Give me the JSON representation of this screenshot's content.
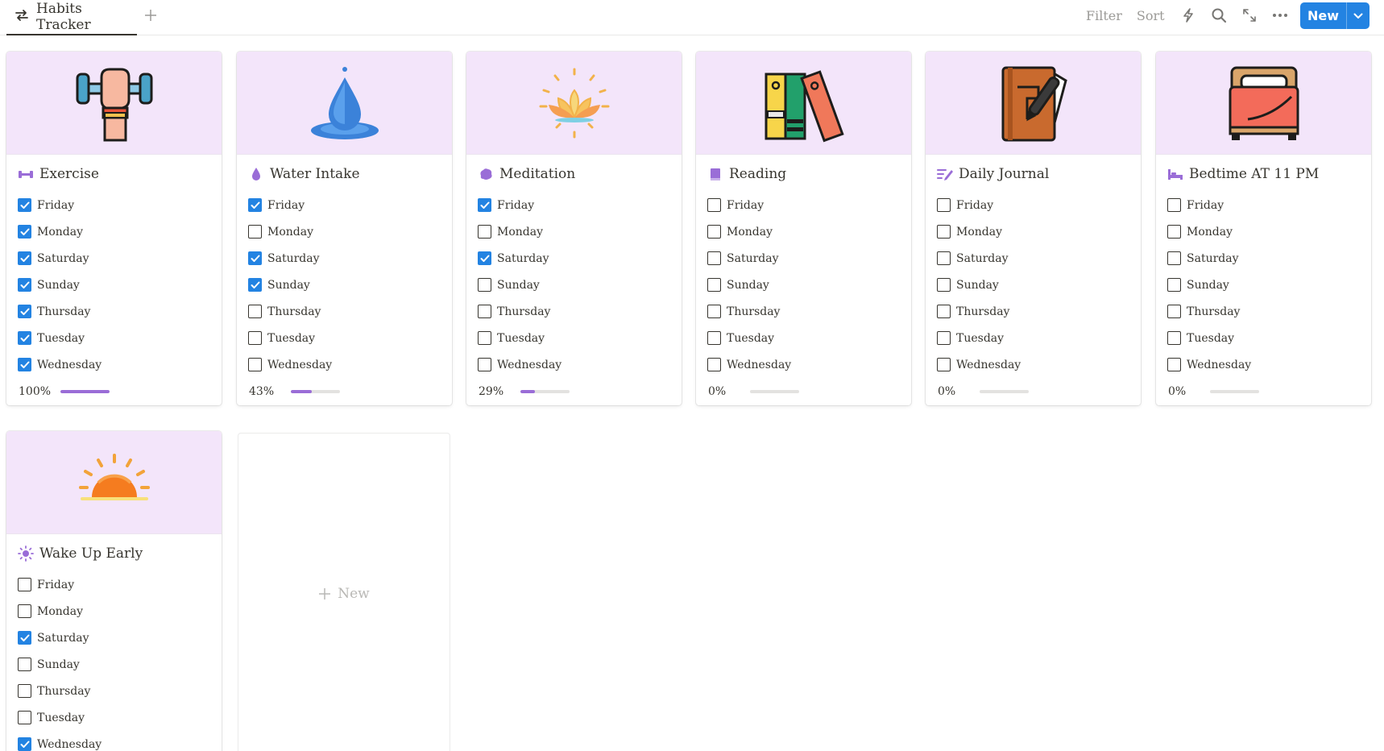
{
  "toolbar": {
    "view_name": "Habits Tracker",
    "filter_label": "Filter",
    "sort_label": "Sort",
    "new_label": "New",
    "accent": "#2383e2"
  },
  "days": [
    "Friday",
    "Monday",
    "Saturday",
    "Sunday",
    "Thursday",
    "Tuesday",
    "Wednesday"
  ],
  "cards": [
    {
      "title": "Exercise",
      "icon": "dumbbell-icon",
      "cover": "dumbbell-arm-illustration",
      "checked": [
        true,
        true,
        true,
        true,
        true,
        true,
        true
      ],
      "progress_label": "100%",
      "progress": 1.0
    },
    {
      "title": "Water Intake",
      "icon": "water-drop-icon",
      "cover": "water-drop-illustration",
      "checked": [
        true,
        false,
        true,
        true,
        false,
        false,
        false
      ],
      "progress_label": "43%",
      "progress": 0.43
    },
    {
      "title": "Meditation",
      "icon": "brain-icon",
      "cover": "lotus-illustration",
      "checked": [
        true,
        false,
        true,
        false,
        false,
        false,
        false
      ],
      "progress_label": "29%",
      "progress": 0.29
    },
    {
      "title": "Reading",
      "icon": "book-icon",
      "cover": "books-illustration",
      "checked": [
        false,
        false,
        false,
        false,
        false,
        false,
        false
      ],
      "progress_label": "0%",
      "progress": 0
    },
    {
      "title": "Daily Journal",
      "icon": "pen-list-icon",
      "cover": "journal-illustration",
      "checked": [
        false,
        false,
        false,
        false,
        false,
        false,
        false
      ],
      "progress_label": "0%",
      "progress": 0
    },
    {
      "title": "Bedtime AT 11 PM",
      "icon": "bed-icon",
      "cover": "bed-illustration",
      "checked": [
        false,
        false,
        false,
        false,
        false,
        false,
        false
      ],
      "progress_label": "0%",
      "progress": 0
    },
    {
      "title": "Wake Up Early",
      "icon": "sun-icon",
      "cover": "sunrise-illustration",
      "checked": [
        false,
        false,
        true,
        false,
        false,
        false,
        true
      ],
      "progress_label": "",
      "progress": null
    }
  ],
  "new_card_label": "New"
}
